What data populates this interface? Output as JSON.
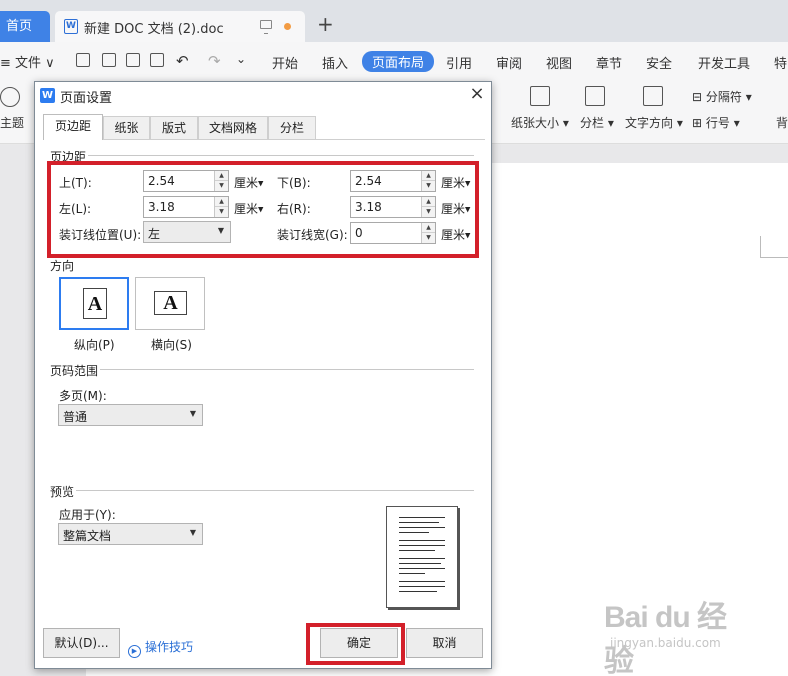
{
  "titlebar": {
    "home_tab": "首页",
    "doc_tab_icon": "W",
    "doc_tab_title": "新建 DOC 文档 (2).doc",
    "new_tab": "+"
  },
  "menubar": {
    "file": "≡ 文件 ∨",
    "tabs": [
      "开始",
      "插入",
      "页面布局",
      "引用",
      "审阅",
      "视图",
      "章节",
      "安全",
      "开发工具",
      "特"
    ],
    "active_tab": "页面布局"
  },
  "ribbon": {
    "theme": "主题",
    "paper_size": "纸张大小",
    "columns": "分栏",
    "text_direction": "文字方向",
    "separator": "分隔符",
    "line_number": "行号",
    "background": "背"
  },
  "dialog": {
    "title_icon": "W",
    "title": "页面设置",
    "close": "×",
    "tabs": [
      "页边距",
      "纸张",
      "版式",
      "文档网格",
      "分栏"
    ],
    "active_tab": "页边距",
    "margins": {
      "section": "页边距",
      "top_label": "上(T):",
      "top_value": "2.54",
      "bottom_label": "下(B):",
      "bottom_value": "2.54",
      "left_label": "左(L):",
      "left_value": "3.18",
      "right_label": "右(R):",
      "right_value": "3.18",
      "gutter_pos_label": "装订线位置(U):",
      "gutter_pos_value": "左",
      "gutter_width_label": "装订线宽(G):",
      "gutter_width_value": "0",
      "unit": "厘米"
    },
    "orientation": {
      "section": "方向",
      "glyph": "A",
      "portrait": "纵向(P)",
      "landscape": "横向(S)",
      "selected": "portrait"
    },
    "pages": {
      "section": "页码范围",
      "multi_label": "多页(M):",
      "multi_value": "普通"
    },
    "preview": {
      "section": "预览",
      "apply_label": "应用于(Y):",
      "apply_value": "整篇文档"
    },
    "buttons": {
      "default": "默认(D)...",
      "tips": "操作技巧",
      "ok": "确定",
      "cancel": "取消"
    }
  },
  "watermark": {
    "big": "Bai du 经验",
    "small": "jingyan.baidu.com"
  },
  "colors": {
    "accent": "#3f82e6",
    "highlight": "#d3202a",
    "link": "#2a6fd6"
  }
}
